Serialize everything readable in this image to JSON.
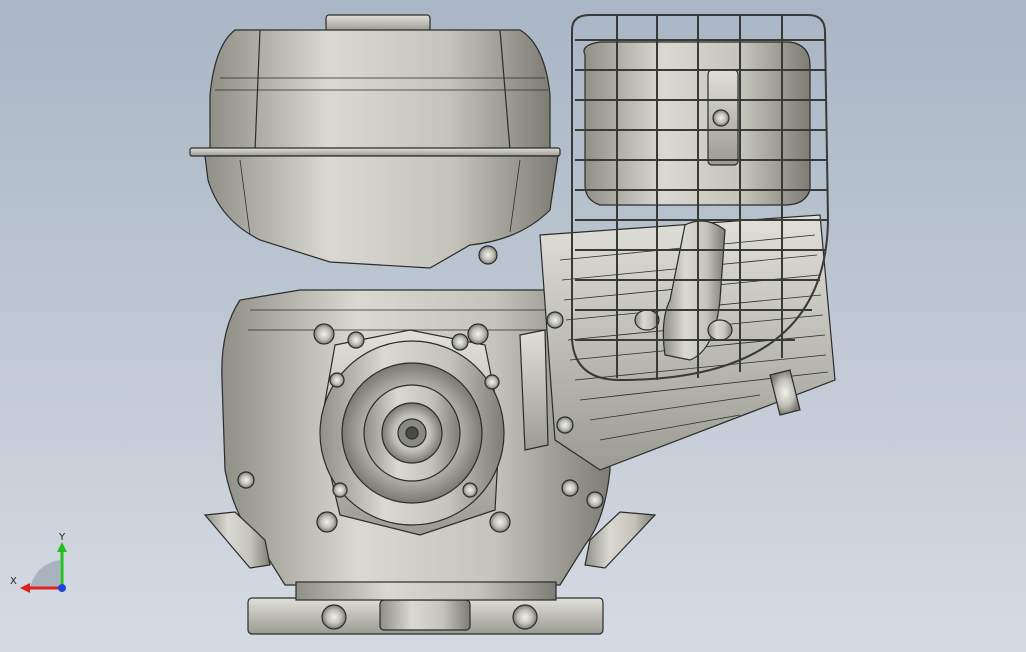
{
  "triad": {
    "x_label": "X",
    "y_label": "Y"
  },
  "colors": {
    "background_top": "#a9b6c6",
    "background_bottom": "#d5dbe3",
    "part_fill": "#c8c8c0",
    "edge": "#2b2b2b",
    "axis_x": "#e02020",
    "axis_y": "#20c020",
    "axis_z": "#2040e0"
  }
}
